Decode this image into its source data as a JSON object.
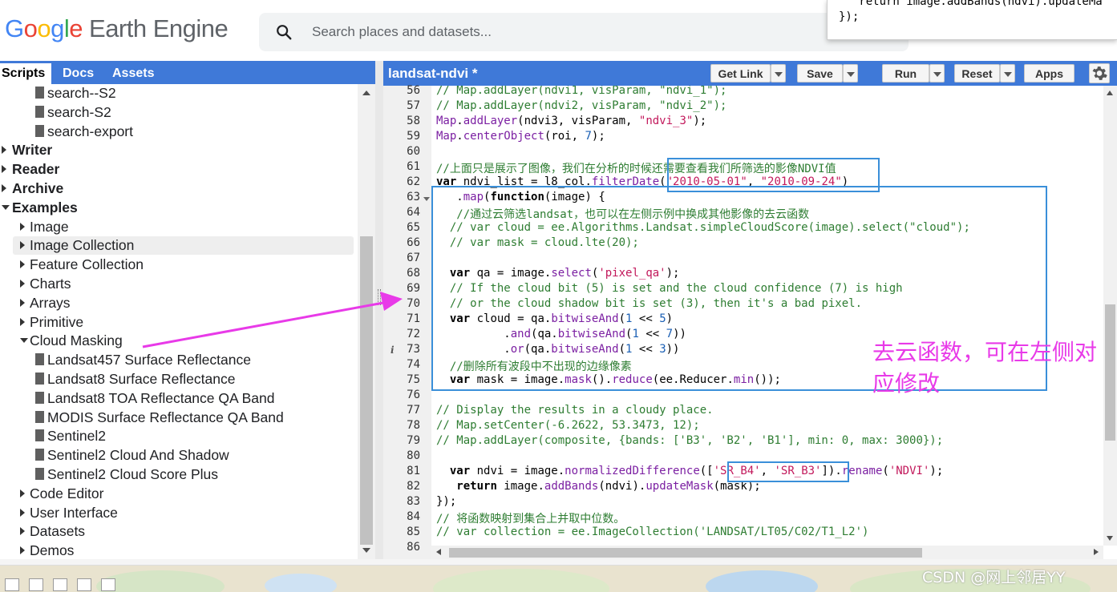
{
  "header": {
    "logo_google": [
      "G",
      "o",
      "o",
      "g",
      "l",
      "e"
    ],
    "logo_product": "Earth Engine",
    "search_placeholder": "Search places and datasets..."
  },
  "popup": {
    "line1": "   return image.addBands(ndvi).updateMa",
    "line2": "});"
  },
  "left_panel": {
    "tabs": [
      "Scripts",
      "Docs",
      "Assets"
    ],
    "active_tab": "Scripts",
    "tree": [
      {
        "label": "search--S2",
        "kind": "file",
        "indent": 44
      },
      {
        "label": "search-S2",
        "kind": "file",
        "indent": 44
      },
      {
        "label": "search-export",
        "kind": "file",
        "indent": 44
      },
      {
        "label": "Writer",
        "kind": "folder-closed",
        "indent": 0,
        "bold": true
      },
      {
        "label": "Reader",
        "kind": "folder-closed",
        "indent": 0,
        "bold": true
      },
      {
        "label": "Archive",
        "kind": "folder-closed",
        "indent": 0,
        "bold": true
      },
      {
        "label": "Examples",
        "kind": "folder-open",
        "indent": 0,
        "bold": true
      },
      {
        "label": "Image",
        "kind": "folder-closed",
        "indent": 22
      },
      {
        "label": "Image Collection",
        "kind": "folder-closed",
        "indent": 22,
        "selected": true
      },
      {
        "label": "Feature Collection",
        "kind": "folder-closed",
        "indent": 22
      },
      {
        "label": "Charts",
        "kind": "folder-closed",
        "indent": 22
      },
      {
        "label": "Arrays",
        "kind": "folder-closed",
        "indent": 22
      },
      {
        "label": "Primitive",
        "kind": "folder-closed",
        "indent": 22
      },
      {
        "label": "Cloud Masking",
        "kind": "folder-open",
        "indent": 22
      },
      {
        "label": "Landsat457 Surface Reflectance",
        "kind": "file",
        "indent": 44
      },
      {
        "label": "Landsat8 Surface Reflectance",
        "kind": "file",
        "indent": 44
      },
      {
        "label": "Landsat8 TOA Reflectance QA Band",
        "kind": "file",
        "indent": 44
      },
      {
        "label": "MODIS Surface Reflectance QA Band",
        "kind": "file",
        "indent": 44
      },
      {
        "label": "Sentinel2",
        "kind": "file",
        "indent": 44
      },
      {
        "label": "Sentinel2 Cloud And Shadow",
        "kind": "file",
        "indent": 44
      },
      {
        "label": "Sentinel2 Cloud Score Plus",
        "kind": "file",
        "indent": 44
      },
      {
        "label": "Code Editor",
        "kind": "folder-closed",
        "indent": 22
      },
      {
        "label": "User Interface",
        "kind": "folder-closed",
        "indent": 22
      },
      {
        "label": "Datasets",
        "kind": "folder-closed",
        "indent": 22
      },
      {
        "label": "Demos",
        "kind": "folder-closed",
        "indent": 22
      }
    ]
  },
  "editor": {
    "title": "landsat-ndvi *",
    "buttons": {
      "get_link": "Get Link",
      "save": "Save",
      "run": "Run",
      "reset": "Reset",
      "apps": "Apps"
    },
    "gear_icon": "gear-icon",
    "lines": [
      {
        "n": 56,
        "html": "<span class='cm'>// Map.addLayer(ndvi1, visParam, \"ndvi_1\");</span>"
      },
      {
        "n": 57,
        "html": "<span class='cm'>// Map.addLayer(ndvi2, visParam, \"ndvi_2\");</span>"
      },
      {
        "n": 58,
        "html": "<span class='fn'>Map</span>.<span class='fn'>addLayer</span>(ndvi3, visParam, <span class='st'>\"ndvi_3\"</span>);"
      },
      {
        "n": 59,
        "html": "<span class='fn'>Map</span>.<span class='fn'>centerObject</span>(roi, <span class='num'>7</span>);"
      },
      {
        "n": 60,
        "html": ""
      },
      {
        "n": 61,
        "html": "<span class='cm'>//<span class='cjk'>上面只是展示了图像，我们在分析的时候还需要查看我们所筛选的影像</span>NDVI<span class='cjk'>值</span></span>"
      },
      {
        "n": 62,
        "html": "<span class='kw'>var</span> ndvi_list = l8_col.<span class='fn'>filterDate</span>(<span class='st'>\"2010-05-01\"</span>, <span class='st'>\"2010-09-24\"</span>)"
      },
      {
        "n": 63,
        "html": "   .<span class='fn'>map</span>(<span class='kw'>function</span>(image) {",
        "fold": true
      },
      {
        "n": 64,
        "html": "   <span class='cm'>//<span class='cjk'>通过云筛选</span>landsat<span class='cjk'>，也可以在左侧示例中换成其他影像的去云函数</span></span>"
      },
      {
        "n": 65,
        "html": "  <span class='cm'>// var cloud = ee.Algorithms.Landsat.simpleCloudScore(image).select(\"cloud\");</span>"
      },
      {
        "n": 66,
        "html": "  <span class='cm'>// var mask = cloud.lte(20);</span>"
      },
      {
        "n": 67,
        "html": ""
      },
      {
        "n": 68,
        "html": "  <span class='kw'>var</span> qa = image.<span class='fn'>select</span>(<span class='st'>'pixel_qa'</span>);"
      },
      {
        "n": 69,
        "html": "  <span class='cm'>// If the cloud bit (5) is set and the cloud confidence (7) is high</span>"
      },
      {
        "n": 70,
        "html": "  <span class='cm'>// or the cloud shadow bit is set (3), then it's a bad pixel.</span>"
      },
      {
        "n": 71,
        "html": "  <span class='kw'>var</span> cloud = qa.<span class='fn'>bitwiseAnd</span>(<span class='num'>1</span> << <span class='num'>5</span>)"
      },
      {
        "n": 72,
        "html": "          .<span class='fn'>and</span>(qa.<span class='fn'>bitwiseAnd</span>(<span class='num'>1</span> << <span class='num'>7</span>))"
      },
      {
        "n": 73,
        "html": "          .<span class='fn'>or</span>(qa.<span class='fn'>bitwiseAnd</span>(<span class='num'>1</span> << <span class='num'>3</span>))",
        "info": true
      },
      {
        "n": 74,
        "html": "  <span class='cm'>//<span class='cjk'>删除所有波段中不出现的边缘像素</span></span>"
      },
      {
        "n": 75,
        "html": "  <span class='kw'>var</span> mask = image.<span class='fn'>mask</span>().<span class='fn'>reduce</span>(ee.Reducer.<span class='fn'>min</span>());"
      },
      {
        "n": 76,
        "html": ""
      },
      {
        "n": 77,
        "html": "<span class='cm'>// Display the results in a cloudy place.</span>"
      },
      {
        "n": 78,
        "html": "<span class='cm'>// Map.setCenter(-6.2622, 53.3473, 12);</span>"
      },
      {
        "n": 79,
        "html": "<span class='cm'>// Map.addLayer(composite, {bands: ['B3', 'B2', 'B1'], min: 0, max: 3000});</span>"
      },
      {
        "n": 80,
        "html": ""
      },
      {
        "n": 81,
        "html": "  <span class='kw'>var</span> ndvi = image.<span class='fn'>normalizedDifference</span>([<span class='st'>'SR_B4'</span>, <span class='st'>'SR_B3'</span>]).<span class='fn'>rename</span>(<span class='st'>'NDVI'</span>);"
      },
      {
        "n": 82,
        "html": "   <span class='kw'>return</span> image.<span class='fn'>addBands</span>(ndvi).<span class='fn'>updateMask</span>(mask);"
      },
      {
        "n": 83,
        "html": "});"
      },
      {
        "n": 84,
        "html": "<span class='cm'>// <span class='cjk'>将函数映射到集合上并取中位数。</span></span>"
      },
      {
        "n": 85,
        "html": "<span class='cm'>// var collection = ee.ImageCollection('LANDSAT/LT05/C02/T1_L2')</span>"
      },
      {
        "n": 86,
        "html": ""
      }
    ]
  },
  "annotation": {
    "note": "去云函数，可在左侧对应修改",
    "arrow_color": "#e83ae8",
    "box_color": "#3a8fd9"
  },
  "watermark": "CSDN @网上邻居YY"
}
